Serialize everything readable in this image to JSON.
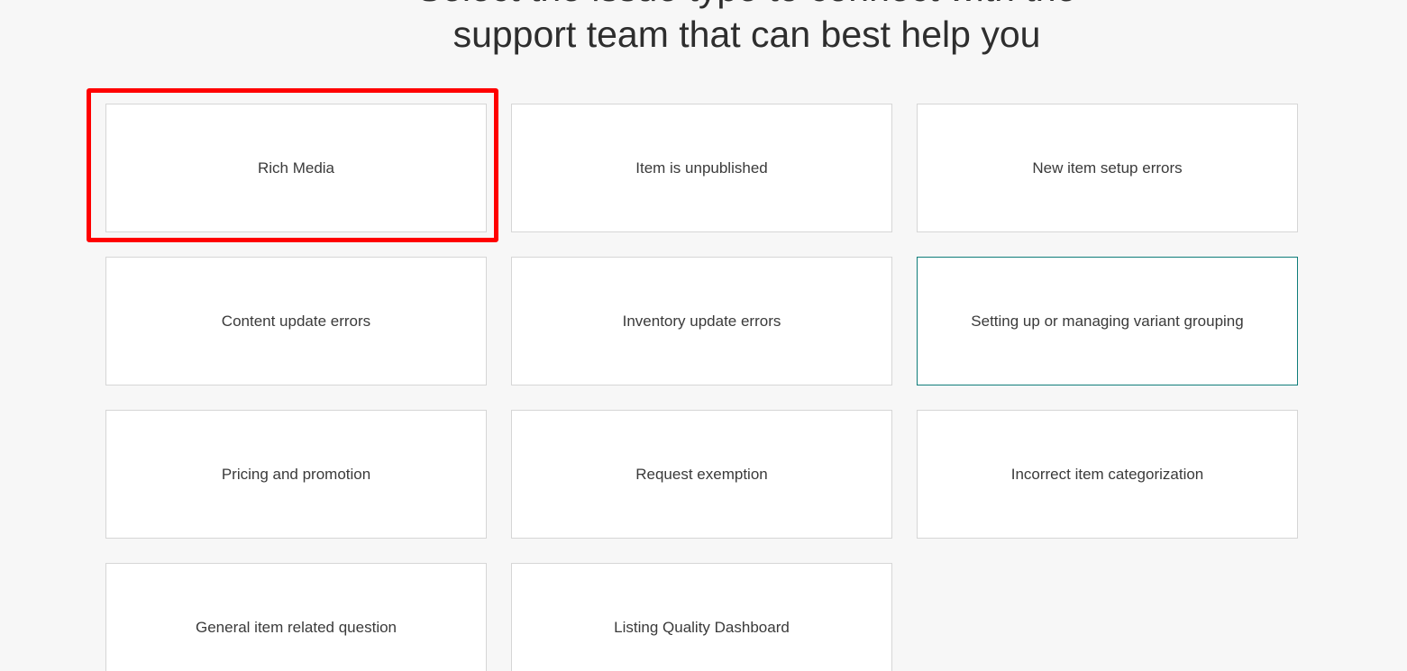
{
  "heading": {
    "line_partial": "Select the issue type to connect with the",
    "line_main": "support team that can best help you"
  },
  "options": [
    {
      "label": "Rich Media",
      "highlighted": true,
      "active": false
    },
    {
      "label": "Item is unpublished",
      "highlighted": false,
      "active": false
    },
    {
      "label": "New item setup errors",
      "highlighted": false,
      "active": false
    },
    {
      "label": "Content update errors",
      "highlighted": false,
      "active": false
    },
    {
      "label": "Inventory update errors",
      "highlighted": false,
      "active": false
    },
    {
      "label": "Setting up or managing variant grouping",
      "highlighted": false,
      "active": true
    },
    {
      "label": "Pricing and promotion",
      "highlighted": false,
      "active": false
    },
    {
      "label": "Request exemption",
      "highlighted": false,
      "active": false
    },
    {
      "label": "Incorrect item categorization",
      "highlighted": false,
      "active": false
    },
    {
      "label": "General item related question",
      "highlighted": false,
      "active": false
    },
    {
      "label": "Listing Quality Dashboard",
      "highlighted": false,
      "active": false
    }
  ],
  "colors": {
    "background": "#f7f7f7",
    "card_border": "#d6d6d6",
    "active_border": "#0f7d7a",
    "highlight": "#ff0000",
    "text": "#3a3a3a"
  }
}
